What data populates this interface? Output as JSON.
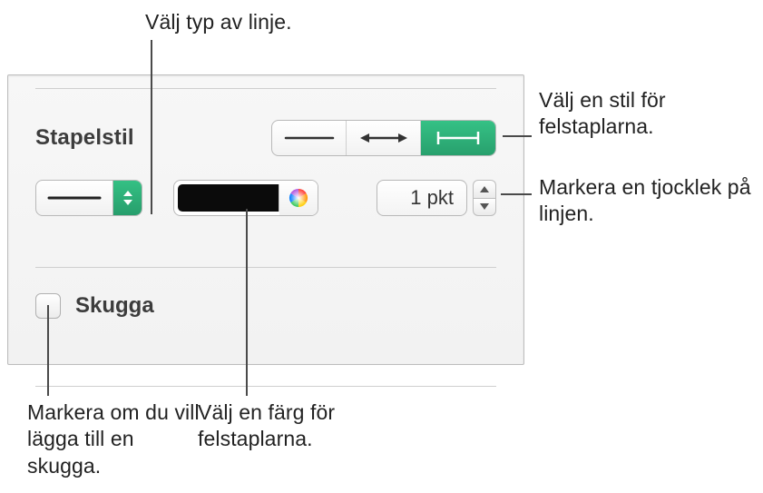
{
  "panel": {
    "sectionLabel": "Stapelstil",
    "thicknessValue": "1 pkt",
    "shadowLabel": "Skugga",
    "colorSwatch": "#0b0b0b",
    "accent": "#2fb279",
    "errorbarStyles": [
      "line",
      "arrow",
      "cap"
    ],
    "errorbarSelected": "cap"
  },
  "callouts": {
    "lineType": "Välj typ av linje.",
    "errorbarStyle": "Välj en stil för felstaplarna.",
    "thickness": "Markera en tjocklek på linjen.",
    "color": "Välj en färg för felstaplarna.",
    "shadow": "Markera om du vill lägga till en skugga."
  }
}
